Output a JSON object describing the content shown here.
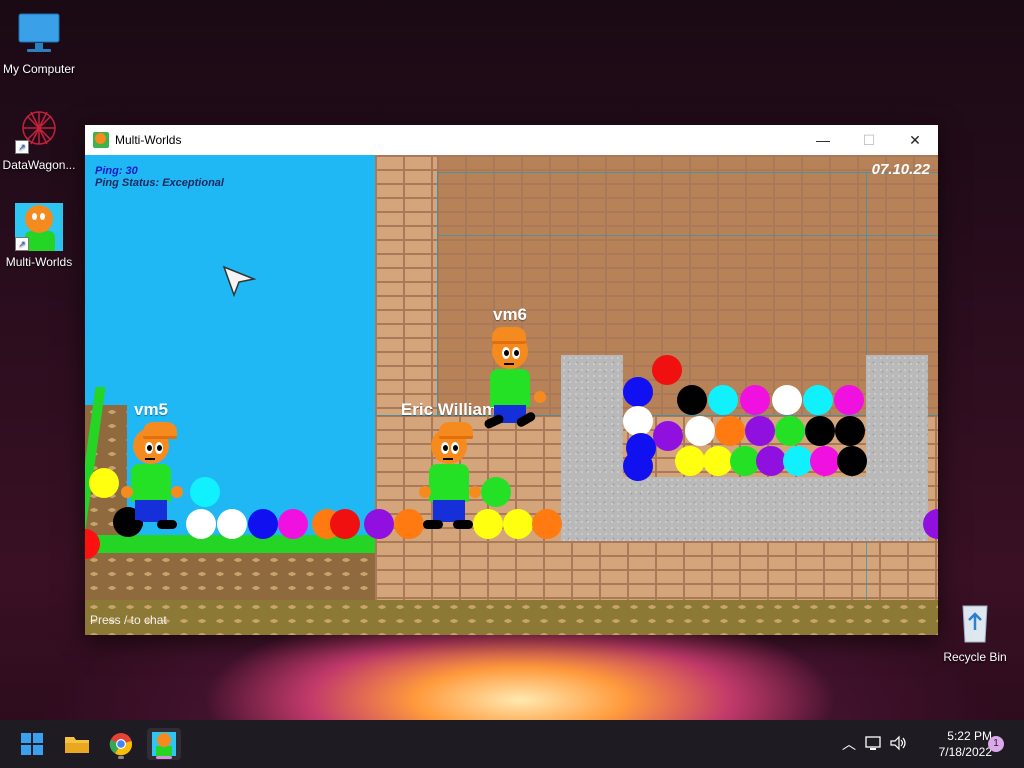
{
  "desktop": {
    "icons": [
      {
        "label": "My Computer",
        "icon": "monitor-icon"
      },
      {
        "label": "DataWagon...",
        "icon": "datawagon-icon"
      },
      {
        "label": "Multi-Worlds",
        "icon": "multi-worlds-icon"
      },
      {
        "label": "Recycle Bin",
        "icon": "recycle-bin-icon"
      }
    ]
  },
  "window": {
    "title": "Multi-Worlds",
    "controls": {
      "minimize": "—",
      "maximize": "☐",
      "close": "✕"
    }
  },
  "game": {
    "ping_label": "Ping: 30",
    "ping_status": "Ping Status: Exceptional",
    "date": "07.10.22",
    "chat_hint": "Press / to chat",
    "players": [
      "vm5",
      "Eric William",
      "vm6"
    ]
  },
  "taskbar": {
    "apps": [
      "start-icon",
      "file-explorer-icon",
      "chrome-icon",
      "multi-worlds-icon"
    ],
    "time": "5:22 PM",
    "date": "7/18/2022",
    "notifications": "1"
  },
  "colors": {
    "sky": "#1fb8f5",
    "brick": "#d4a47a",
    "grass": "#25d525",
    "player_body": "#25e125",
    "player_head": "#f58b1f",
    "player_pants": "#1530d8"
  }
}
